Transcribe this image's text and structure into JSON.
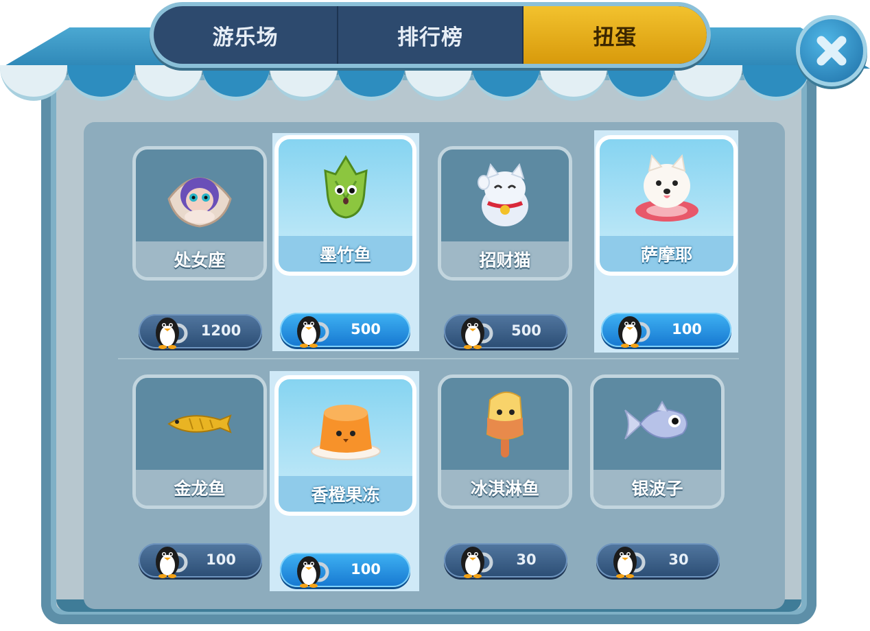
{
  "tabs": [
    {
      "label": "游乐场",
      "active": false
    },
    {
      "label": "排行榜",
      "active": false
    },
    {
      "label": "扭蛋",
      "active": true
    }
  ],
  "close_icon": "close-x-icon",
  "currency_icon": "penguin-coin-icon",
  "items": [
    {
      "name": "处女座",
      "price": "1200",
      "selected": false,
      "icon": "virgo-clam-girl-icon"
    },
    {
      "name": "墨竹鱼",
      "price": "500",
      "selected": true,
      "icon": "bamboo-fish-icon"
    },
    {
      "name": "招财猫",
      "price": "500",
      "selected": false,
      "icon": "lucky-cat-icon"
    },
    {
      "name": "萨摩耶",
      "price": "100",
      "selected": true,
      "icon": "samoyed-dog-icon"
    },
    {
      "name": "金龙鱼",
      "price": "100",
      "selected": false,
      "icon": "golden-arowana-icon"
    },
    {
      "name": "香橙果冻",
      "price": "100",
      "selected": true,
      "icon": "orange-jelly-icon"
    },
    {
      "name": "冰淇淋鱼",
      "price": "30",
      "selected": false,
      "icon": "ice-cream-fish-icon"
    },
    {
      "name": "银波子",
      "price": "30",
      "selected": false,
      "icon": "silver-fish-icon"
    }
  ],
  "colors": {
    "active_tab": "#e7b11c",
    "tab_bg": "#2d4a6e",
    "selected_button": "#2a98e6",
    "normal_button": "#3d618a"
  }
}
